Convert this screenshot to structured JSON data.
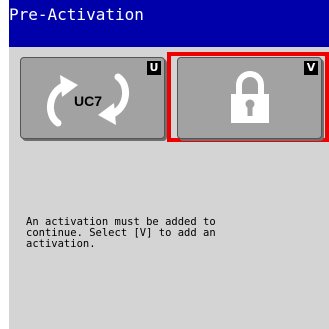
{
  "title": "Pre-Activation",
  "softkeys": [
    {
      "key_letter": "U",
      "icon": "uc7-cycle-icon",
      "icon_label": "UC7"
    },
    {
      "key_letter": "V",
      "icon": "lock-icon",
      "selected": true
    }
  ],
  "message": "An activation must be added to\ncontinue. Select [V] to add an\nactivation.",
  "colors": {
    "title_bar": "#0000aa",
    "screen_bg": "#d4d4d4",
    "key_bg": "#a2a2a2",
    "selection": "#ee0000"
  }
}
